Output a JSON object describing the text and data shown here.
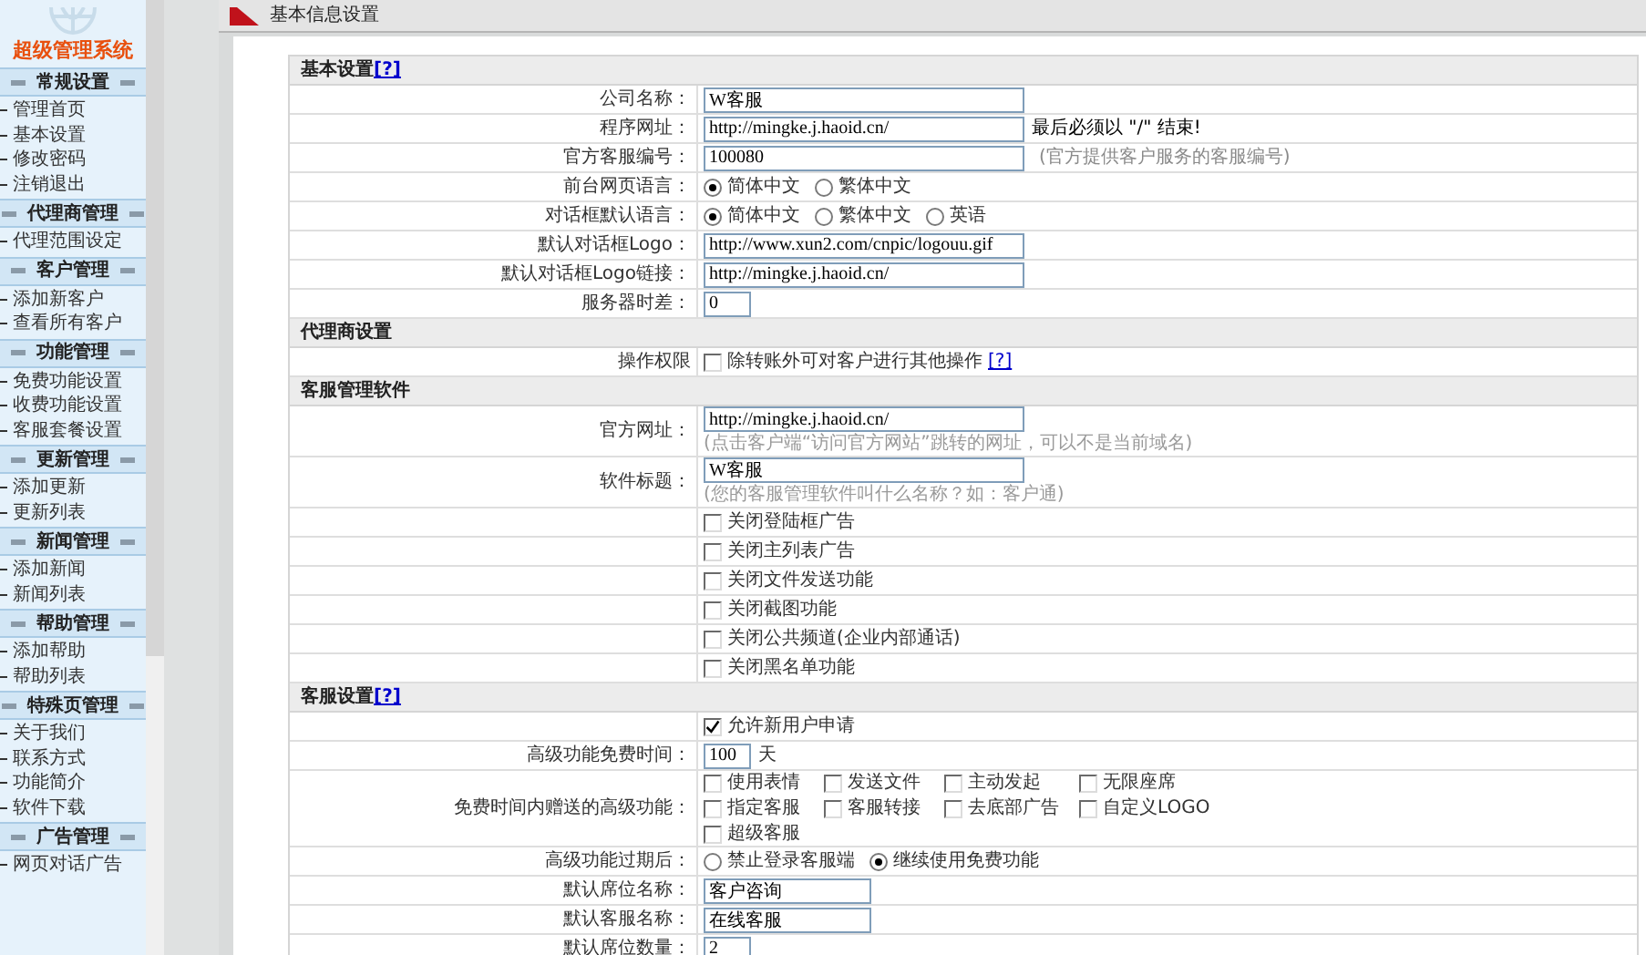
{
  "sidebar": {
    "title": "超级管理系统",
    "groups": [
      {
        "title": "常规设置",
        "items": [
          "管理首页",
          "基本设置",
          "修改密码",
          "注销退出"
        ]
      },
      {
        "title": "代理商管理",
        "items": [
          "代理范围设定"
        ]
      },
      {
        "title": "客户管理",
        "items": [
          "添加新客户",
          "查看所有客户"
        ]
      },
      {
        "title": "功能管理",
        "items": [
          "免费功能设置",
          "收费功能设置",
          "客服套餐设置"
        ]
      },
      {
        "title": "更新管理",
        "items": [
          "添加更新",
          "更新列表"
        ]
      },
      {
        "title": "新闻管理",
        "items": [
          "添加新闻",
          "新闻列表"
        ]
      },
      {
        "title": "帮助管理",
        "items": [
          "添加帮助",
          "帮助列表"
        ]
      },
      {
        "title": "特殊页管理",
        "items": [
          "关于我们",
          "联系方式",
          "功能简介",
          "软件下载"
        ]
      },
      {
        "title": "广告管理",
        "items": [
          "网页对话广告"
        ]
      }
    ]
  },
  "page_title": "基本信息设置",
  "sections": [
    {
      "title": "基本设置",
      "help": "[?]",
      "rows": [
        {
          "kind": "input",
          "label": "公司名称：",
          "value": "W客服"
        },
        {
          "kind": "input",
          "label": "程序网址：",
          "value": "http://mingke.j.haoid.cn/",
          "note": "最后必须以 \"/\" 结束!"
        },
        {
          "kind": "input",
          "label": "官方客服编号：",
          "value": "100080",
          "muted_note": "(官方提供客户服务的客服编号)"
        },
        {
          "kind": "radio",
          "label": "前台网页语言：",
          "options": [
            {
              "label": "简体中文",
              "selected": true
            },
            {
              "label": "繁体中文",
              "selected": false
            }
          ]
        },
        {
          "kind": "radio",
          "label": "对话框默认语言：",
          "options": [
            {
              "label": "简体中文",
              "selected": true
            },
            {
              "label": "繁体中文",
              "selected": false
            },
            {
              "label": "英语",
              "selected": false
            }
          ]
        },
        {
          "kind": "input",
          "label": "默认对话框Logo：",
          "value": "http://www.xun2.com/cnpic/logouu.gif"
        },
        {
          "kind": "input",
          "label": "默认对话框Logo链接：",
          "value": "http://mingke.j.haoid.cn/"
        },
        {
          "kind": "short_input",
          "label": "服务器时差：",
          "value": "0"
        }
      ]
    },
    {
      "title": "代理商设置",
      "rows": [
        {
          "kind": "checkbox",
          "label": "操作权限",
          "options": [
            {
              "label": "除转账外可对客户进行其他操作",
              "checked": false,
              "help": "[?]"
            }
          ]
        }
      ]
    },
    {
      "title": "客服管理软件",
      "rows": [
        {
          "kind": "input",
          "label": "官方网址：",
          "value": "http://mingke.j.haoid.cn/",
          "hint": "(点击客户端“访问官方网站”跳转的网址，可以不是当前域名)"
        },
        {
          "kind": "input",
          "label": "软件标题：",
          "value": "W客服",
          "hint": "(您的客服管理软件叫什么名称？如：客户通)"
        },
        {
          "kind": "checkbox",
          "options": [
            {
              "label": "关闭登陆框广告",
              "checked": false
            }
          ]
        },
        {
          "kind": "checkbox",
          "options": [
            {
              "label": "关闭主列表广告",
              "checked": false
            }
          ]
        },
        {
          "kind": "checkbox",
          "options": [
            {
              "label": "关闭文件发送功能",
              "checked": false
            }
          ]
        },
        {
          "kind": "checkbox",
          "options": [
            {
              "label": "关闭截图功能",
              "checked": false
            }
          ]
        },
        {
          "kind": "checkbox",
          "options": [
            {
              "label": "关闭公共频道(企业内部通话)",
              "checked": false
            }
          ]
        },
        {
          "kind": "checkbox",
          "options": [
            {
              "label": "关闭黑名单功能",
              "checked": false
            }
          ]
        }
      ]
    },
    {
      "title": "客服设置",
      "help": "[?]",
      "rows": [
        {
          "kind": "checkbox",
          "options": [
            {
              "label": "允许新用户申请",
              "checked": true
            }
          ]
        },
        {
          "kind": "short_input",
          "label": "高级功能免费时间：",
          "value": "100",
          "suffix": "天"
        },
        {
          "kind": "checkgrid",
          "label": "免费时间内赠送的高级功能：",
          "options": [
            {
              "label": "使用表情",
              "checked": false
            },
            {
              "label": "发送文件",
              "checked": false
            },
            {
              "label": "主动发起",
              "checked": false
            },
            {
              "label": "无限座席",
              "checked": false
            },
            {
              "label": "指定客服",
              "checked": false
            },
            {
              "label": "客服转接",
              "checked": false
            },
            {
              "label": "去底部广告",
              "checked": false
            },
            {
              "label": "自定义LOGO",
              "checked": false
            },
            {
              "label": "超级客服",
              "checked": false
            }
          ]
        },
        {
          "kind": "radio",
          "label": "高级功能过期后：",
          "options": [
            {
              "label": "禁止登录客服端",
              "selected": false
            },
            {
              "label": "继续使用免费功能",
              "selected": true
            }
          ]
        },
        {
          "kind": "medium_input",
          "label": "默认席位名称：",
          "value": "客户咨询"
        },
        {
          "kind": "medium_input",
          "label": "默认客服名称：",
          "value": "在线客服"
        },
        {
          "kind": "short_input",
          "label": "默认席位数量：",
          "value": "2"
        }
      ]
    }
  ]
}
